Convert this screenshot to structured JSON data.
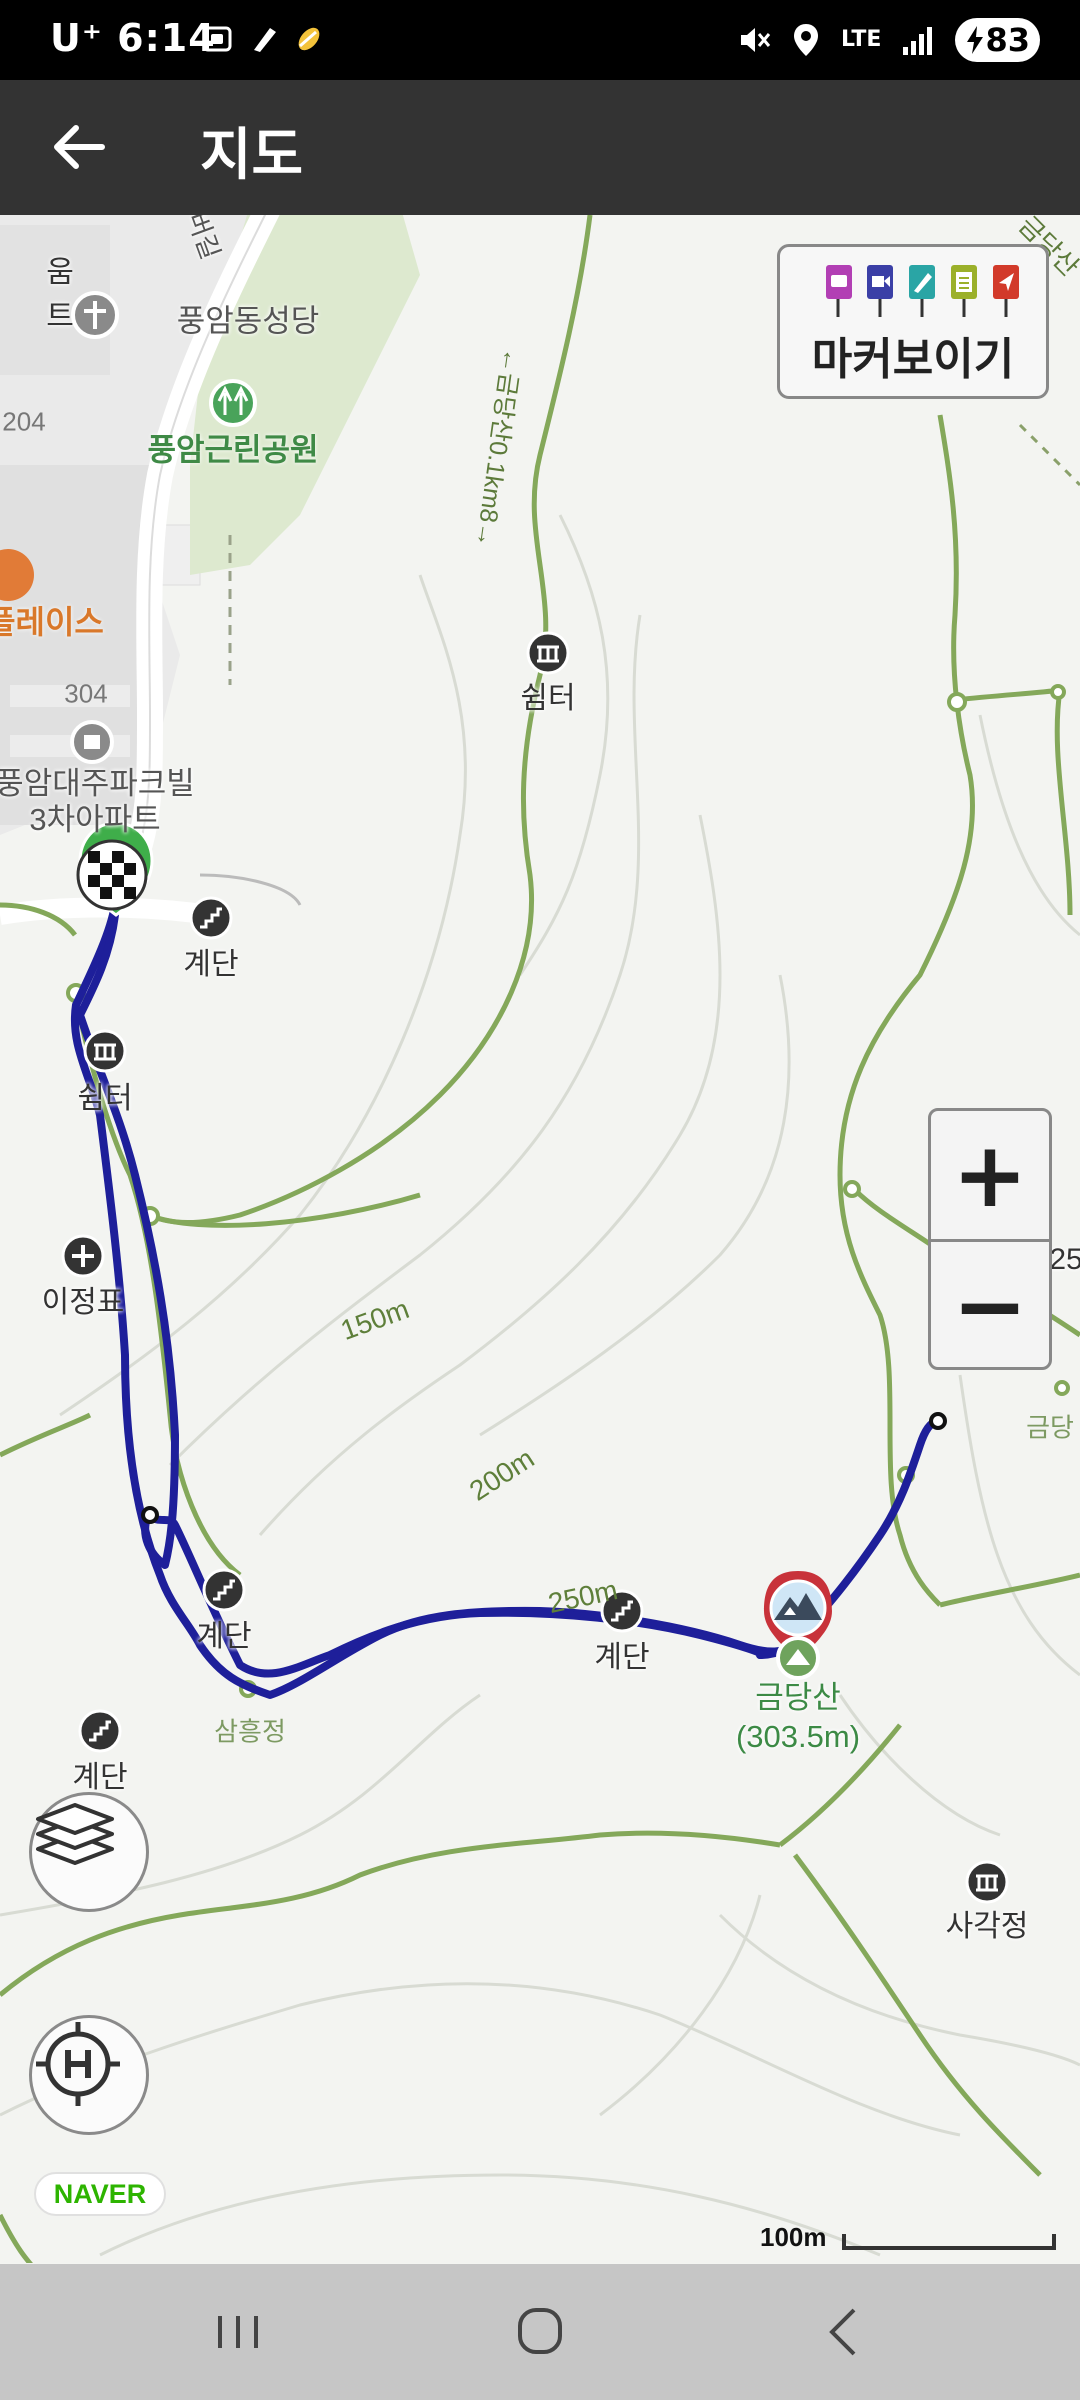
{
  "status": {
    "carrier": "U⁺",
    "time": "6:14",
    "network": "LTE",
    "battery": "83",
    "icons": [
      "screenshot-icon",
      "app-icon",
      "app-icon",
      "mute-icon",
      "location-icon",
      "signal-icon",
      "battery-charging-icon"
    ]
  },
  "appbar": {
    "title": "지도",
    "back_icon": "arrow-left-icon"
  },
  "marker_toggle": {
    "label": "마커보이기",
    "flags": [
      {
        "icon": "camera-icon",
        "color": "#b23fb4"
      },
      {
        "icon": "video-icon",
        "color": "#3b3fa6"
      },
      {
        "icon": "pen-icon",
        "color": "#2aa5a5"
      },
      {
        "icon": "memo-icon",
        "color": "#9bb02a"
      },
      {
        "icon": "navigate-icon",
        "color": "#d23a2a"
      }
    ]
  },
  "map": {
    "places": {
      "church": "풍암동성당",
      "park": "풍암근린공원",
      "apartment": "풍암대주파크빌\n3차아파트",
      "place_left": "플레이스",
      "num_204": "204",
      "num_304": "304",
      "edge_text_1": "움",
      "edge_text_2": "트",
      "road_text": "버길"
    },
    "pois": {
      "shelter_top": "쉼터",
      "stairs_1": "계단",
      "shelter_left": "쉼터",
      "milestone": "이정표",
      "stairs_2": "계단",
      "stairs_3": "계단",
      "stairs_4": "계단",
      "pavilion_samheung": "삼흥정",
      "pavilion_sagak": "사각정",
      "peak_name": "금당산",
      "peak_height": "(303.5m)",
      "edge_geumdang": "금당",
      "edge_25": "25"
    },
    "contours": [
      "150m",
      "200m",
      "250m"
    ],
    "trail_label": "←금당산0.1km8→",
    "trail_label_2": "금당산",
    "provider": "NAVER",
    "scale": "100m"
  },
  "controls": {
    "zoom_in": "+",
    "zoom_out": "−",
    "layers_icon": "layers-icon",
    "home_icon": "home-location-icon"
  },
  "colors": {
    "route": "#1e1f9a",
    "trail": "#7fa552",
    "park": "#d9e8c8",
    "start_marker": "#3fae4a",
    "peak_marker": "#c8323a"
  },
  "navbar": {
    "icons": [
      "recent-apps-icon",
      "home-icon",
      "back-icon"
    ]
  }
}
